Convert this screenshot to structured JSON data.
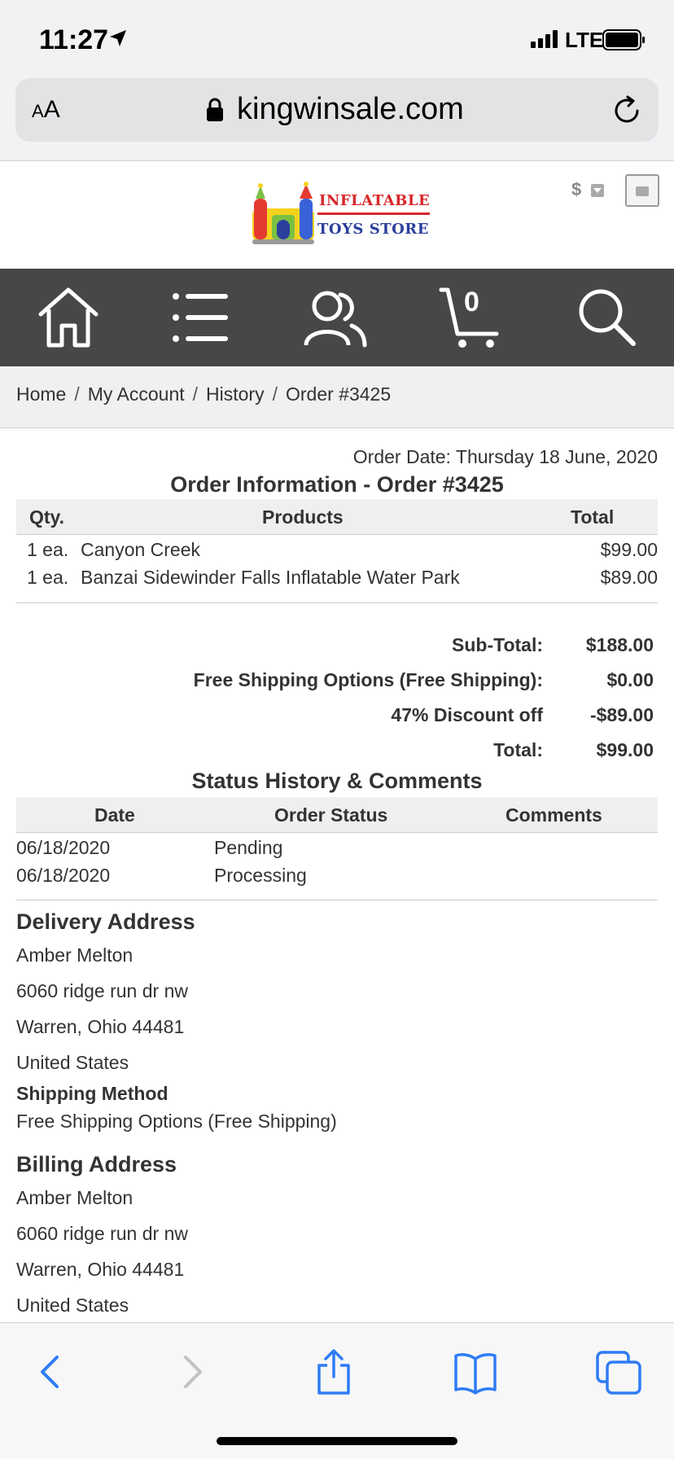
{
  "status_bar": {
    "time": "11:27",
    "network": "LTE"
  },
  "browser": {
    "text_size_label_small": "A",
    "text_size_label_large": "A",
    "url": "kingwinsale.com"
  },
  "header": {
    "logo_line1": "INFLATABLE",
    "logo_line2": "TOYS STORE",
    "currency_symbol": "$"
  },
  "nav": {
    "cart_count": "0"
  },
  "breadcrumb": [
    "Home",
    "My Account",
    "History",
    "Order #3425"
  ],
  "order": {
    "date_line": "Order Date: Thursday 18 June, 2020",
    "title": "Order Information - Order #3425",
    "columns": {
      "qty": "Qty.",
      "products": "Products",
      "total": "Total"
    },
    "items": [
      {
        "qty": "1 ea.",
        "name": "Canyon Creek",
        "total": "$99.00"
      },
      {
        "qty": "1 ea.",
        "name": "Banzai Sidewinder Falls Inflatable Water Park",
        "total": "$89.00"
      }
    ],
    "totals": [
      {
        "label": "Sub-Total:",
        "value": "$188.00"
      },
      {
        "label": "Free Shipping Options (Free Shipping):",
        "value": "$0.00"
      },
      {
        "label": "47% Discount off",
        "value": "-$89.00"
      },
      {
        "label": "Total:",
        "value": "$99.00"
      }
    ]
  },
  "status_history": {
    "title": "Status History & Comments",
    "columns": {
      "date": "Date",
      "status": "Order Status",
      "comments": "Comments"
    },
    "rows": [
      {
        "date": "06/18/2020",
        "status": "Pending",
        "comments": ""
      },
      {
        "date": "06/18/2020",
        "status": "Processing",
        "comments": ""
      }
    ]
  },
  "delivery": {
    "heading": "Delivery Address",
    "lines": [
      "Amber Melton",
      "6060 ridge run dr nw",
      "Warren, Ohio 44481",
      "United States"
    ],
    "shipping_heading": "Shipping Method",
    "shipping_method": "Free Shipping Options (Free Shipping)"
  },
  "billing": {
    "heading": "Billing Address",
    "lines": [
      "Amber Melton",
      "6060 ridge run dr nw",
      "Warren, Ohio 44481",
      "United States"
    ]
  },
  "colors": {
    "nav_bg": "#474747",
    "ios_blue": "#2f7cf6",
    "logo_red": "#d8262b",
    "logo_blue": "#2b3f9c"
  }
}
